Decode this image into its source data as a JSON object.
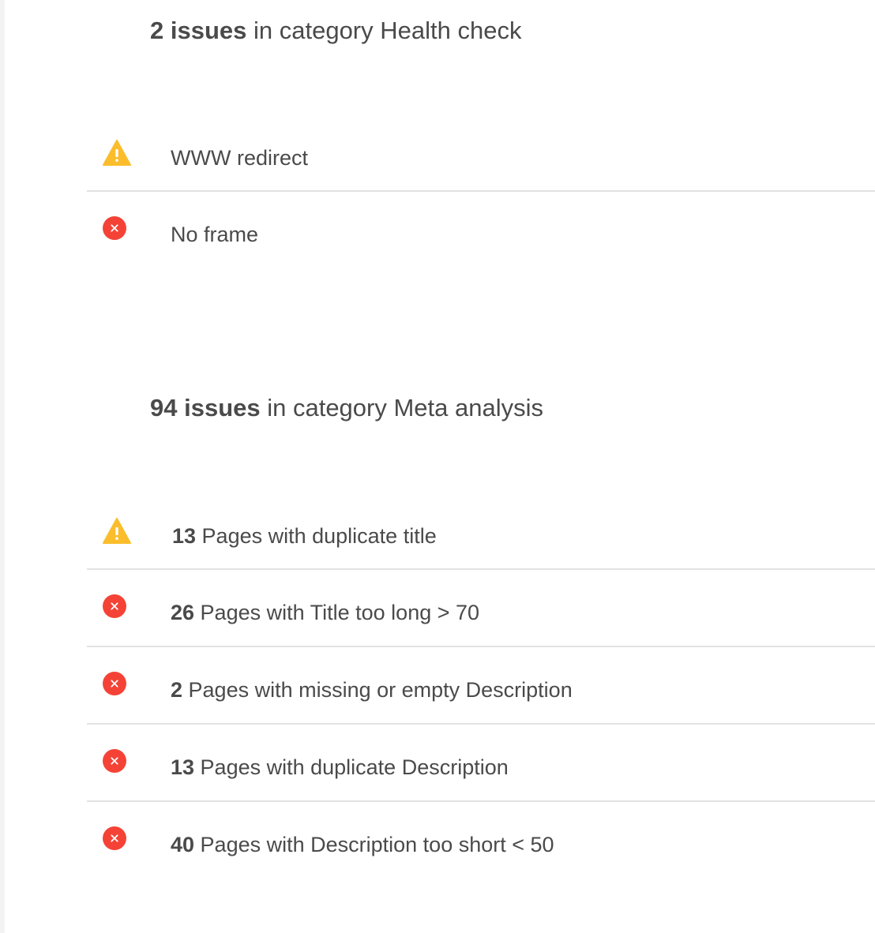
{
  "categories": [
    {
      "count_label": "2 issues",
      "suffix": " in category Health check",
      "issues": [
        {
          "severity": "warning",
          "icon": "warning-triangle-icon",
          "number": "",
          "text": "WWW redirect"
        },
        {
          "severity": "error",
          "icon": "error-circle-icon",
          "number": "",
          "text": "No frame"
        }
      ]
    },
    {
      "count_label": "94 issues",
      "suffix": " in category Meta analysis",
      "issues": [
        {
          "severity": "warning",
          "icon": "warning-triangle-icon",
          "number": "13",
          "text": " Pages with duplicate title"
        },
        {
          "severity": "error",
          "icon": "error-circle-icon",
          "number": "26",
          "text": " Pages with Title too long > 70"
        },
        {
          "severity": "error",
          "icon": "error-circle-icon",
          "number": "2",
          "text": " Pages with missing or empty Description"
        },
        {
          "severity": "error",
          "icon": "error-circle-icon",
          "number": "13",
          "text": " Pages with duplicate Description"
        },
        {
          "severity": "error",
          "icon": "error-circle-icon",
          "number": "40",
          "text": " Pages with Description too short < 50"
        }
      ]
    }
  ],
  "colors": {
    "warning": "#fbbd2c",
    "error": "#f44336",
    "text": "#4a4a4a",
    "divider": "#e2e2e2"
  }
}
